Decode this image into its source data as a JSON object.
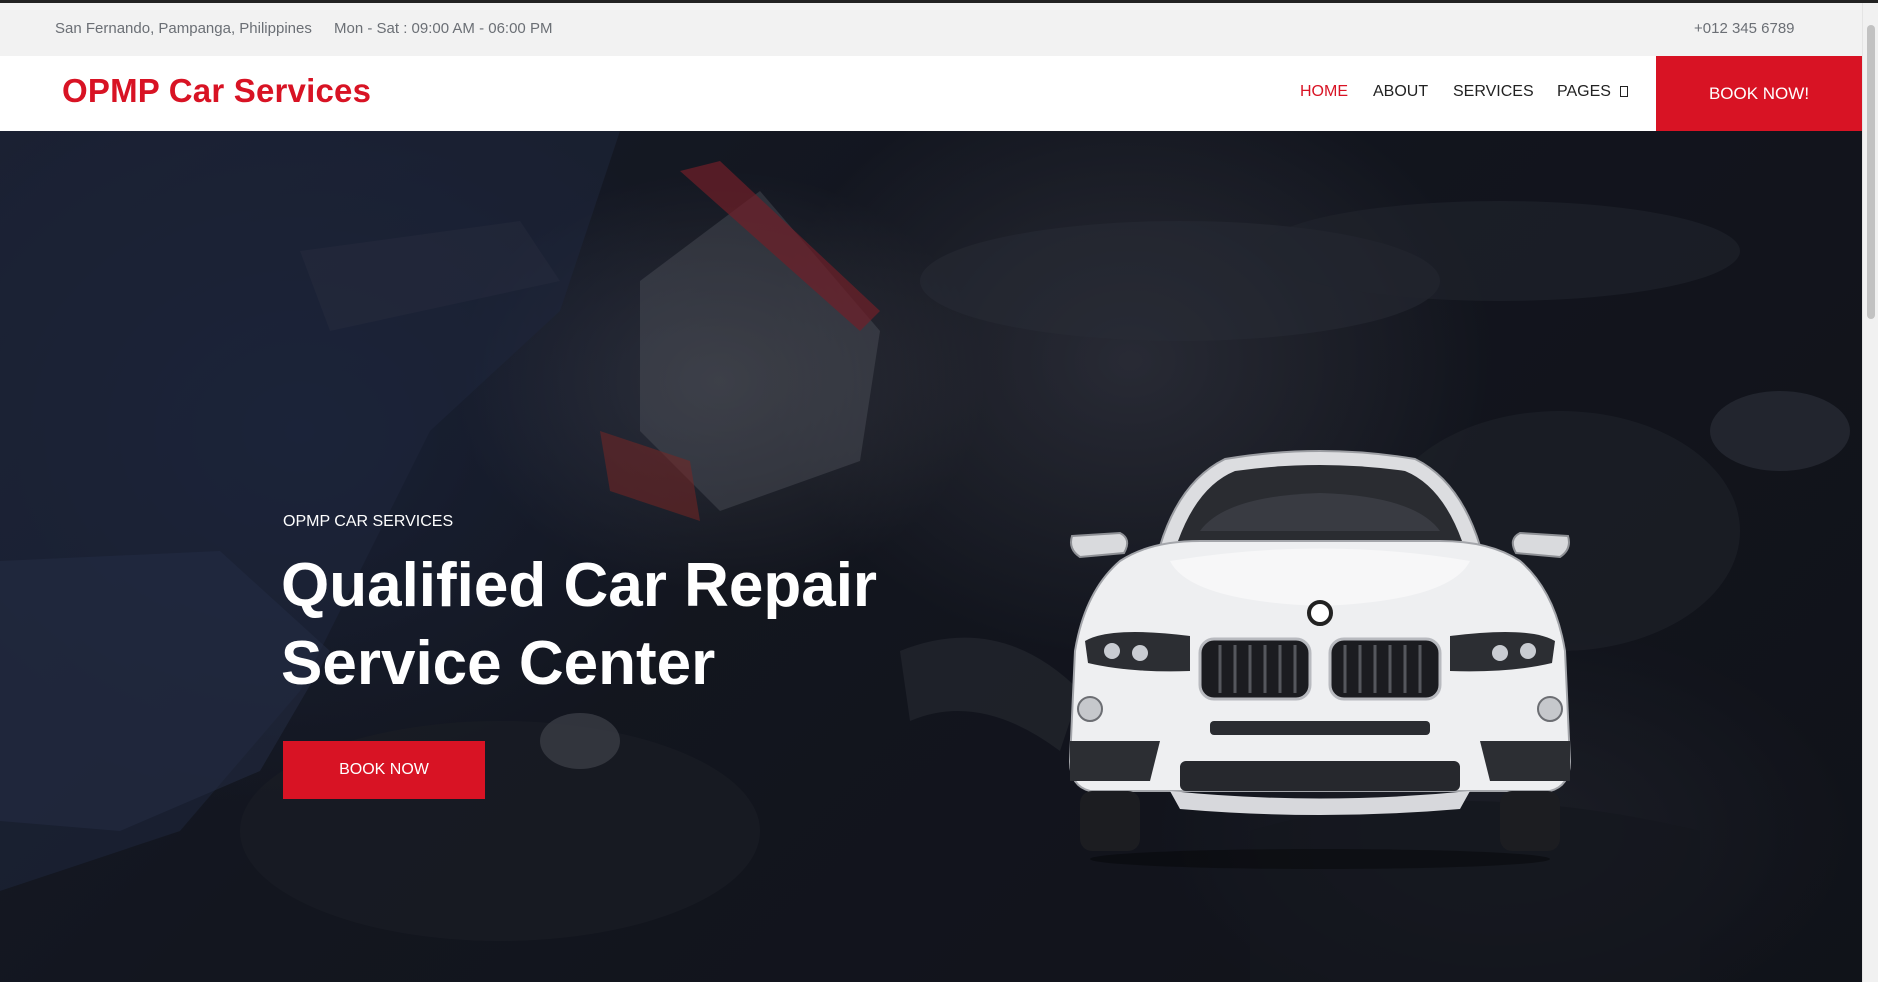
{
  "topbar": {
    "address": "San Fernando, Pampanga, Philippines",
    "hours": "Mon - Sat : 09:00 AM - 06:00 PM",
    "phone": "+012 345 6789"
  },
  "nav": {
    "brand": "OPMP Car Services",
    "items": [
      "HOME",
      "ABOUT",
      "SERVICES",
      "PAGES"
    ],
    "active": "HOME",
    "book_label": "BOOK NOW!"
  },
  "hero": {
    "kicker": "OPMP CAR SERVICES",
    "title": "Qualified Car Repair Service Center",
    "button_label": "BOOK NOW"
  },
  "colors": {
    "accent": "#d81324",
    "text_dark": "#222222",
    "topbar_bg": "#f2f2f2"
  },
  "icons": {
    "pages_dropdown": "chevron-down-icon"
  }
}
